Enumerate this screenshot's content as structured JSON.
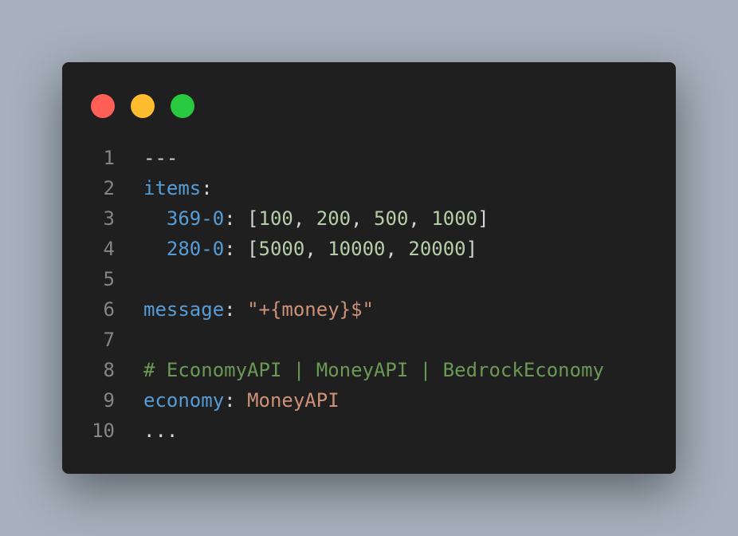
{
  "colors": {
    "background": "#a6b1bd",
    "window": "#1f1f1f",
    "close": "#ff5f57",
    "minimize": "#febc2e",
    "maximize": "#28c840",
    "key": "#569cd6",
    "number": "#b5cea8",
    "string": "#ce9178",
    "comment": "#6a9955",
    "line_number": "#858585"
  },
  "window_controls": [
    {
      "name": "close",
      "icon": "close-dot"
    },
    {
      "name": "minimize",
      "icon": "minimize-dot"
    },
    {
      "name": "maximize",
      "icon": "maximize-dot"
    }
  ],
  "code": {
    "line_numbers": [
      "1",
      "2",
      "3",
      "4",
      "5",
      "6",
      "7",
      "8",
      "9",
      "10"
    ],
    "line1": "---",
    "line2_key": "items",
    "line3_key": "369-0",
    "line3_values": [
      "100",
      "200",
      "500",
      "1000"
    ],
    "line4_key": "280-0",
    "line4_values": [
      "5000",
      "10000",
      "20000"
    ],
    "line6_key": "message",
    "line6_value": "\"+{money}$\"",
    "line8_comment": "# EconomyAPI | MoneyAPI | BedrockEconomy",
    "line9_key": "economy",
    "line9_value": "MoneyAPI",
    "line10": "..."
  }
}
